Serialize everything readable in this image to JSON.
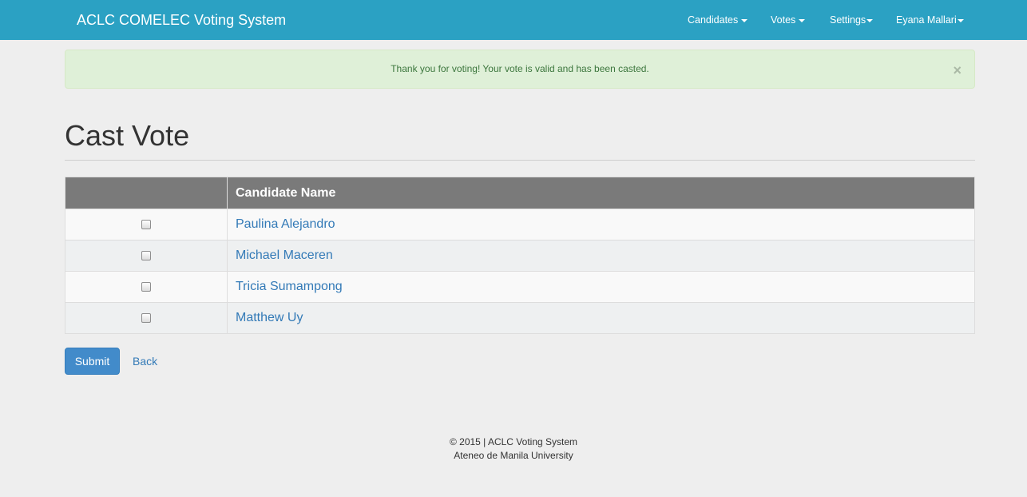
{
  "navbar": {
    "brand": "ACLC COMELEC Voting System",
    "items": [
      {
        "label": "Candidates"
      },
      {
        "label": "Votes"
      },
      {
        "label": "Settings"
      },
      {
        "label": "Eyana Mallari"
      }
    ],
    "color": "#2ba1c3"
  },
  "alert": {
    "message": "Thank you for voting! Your vote is valid and has been casted.",
    "close_label": "×"
  },
  "page": {
    "title": "Cast Vote"
  },
  "table": {
    "headers": [
      "",
      "Candidate Name"
    ],
    "rows": [
      {
        "name": "Paulina Alejandro",
        "checked": false
      },
      {
        "name": "Michael Maceren",
        "checked": false
      },
      {
        "name": "Tricia Sumampong",
        "checked": false
      },
      {
        "name": "Matthew Uy",
        "checked": false
      }
    ]
  },
  "actions": {
    "submit_label": "Submit",
    "back_label": "Back"
  },
  "footer": {
    "line1": "© 2015 | ACLC Voting System",
    "line2": "Ateneo de Manila University"
  }
}
